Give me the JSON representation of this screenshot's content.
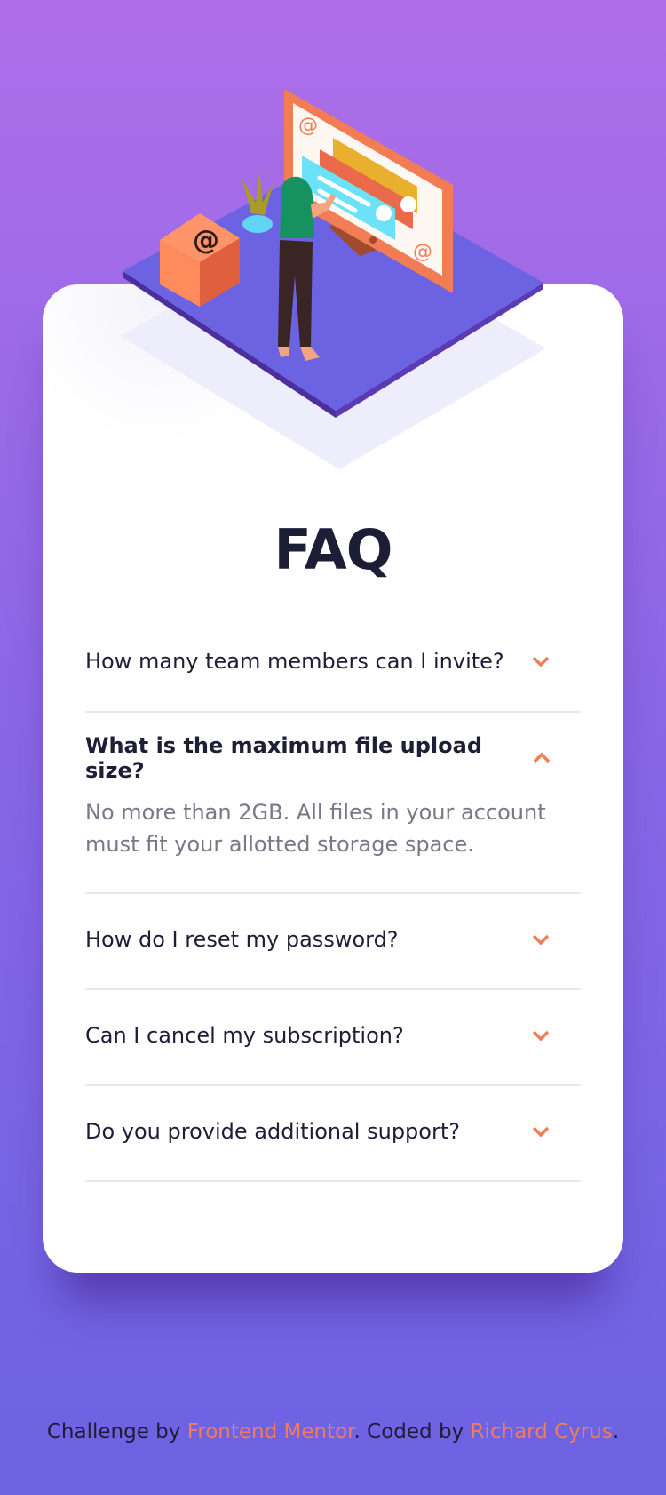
{
  "faq": {
    "title": "FAQ",
    "items": [
      {
        "question": "How many team members can I invite?",
        "open": false
      },
      {
        "question": "What is the maximum file upload size?",
        "open": true,
        "answer": "No more than 2GB. All files in your account must fit your allotted storage space."
      },
      {
        "question": "How do I reset my password?",
        "open": false
      },
      {
        "question": "Can I cancel my subscription?",
        "open": false
      },
      {
        "question": "Do you provide additional support?",
        "open": false
      }
    ]
  },
  "footer": {
    "prefix": "Challenge by ",
    "link1": "Frontend Mentor",
    "middle": ". Coded by ",
    "link2": "Richard Cyrus",
    "suffix": "."
  },
  "colors": {
    "accent": "#f47b56",
    "title": "#1d1e35",
    "answer": "#787887"
  }
}
